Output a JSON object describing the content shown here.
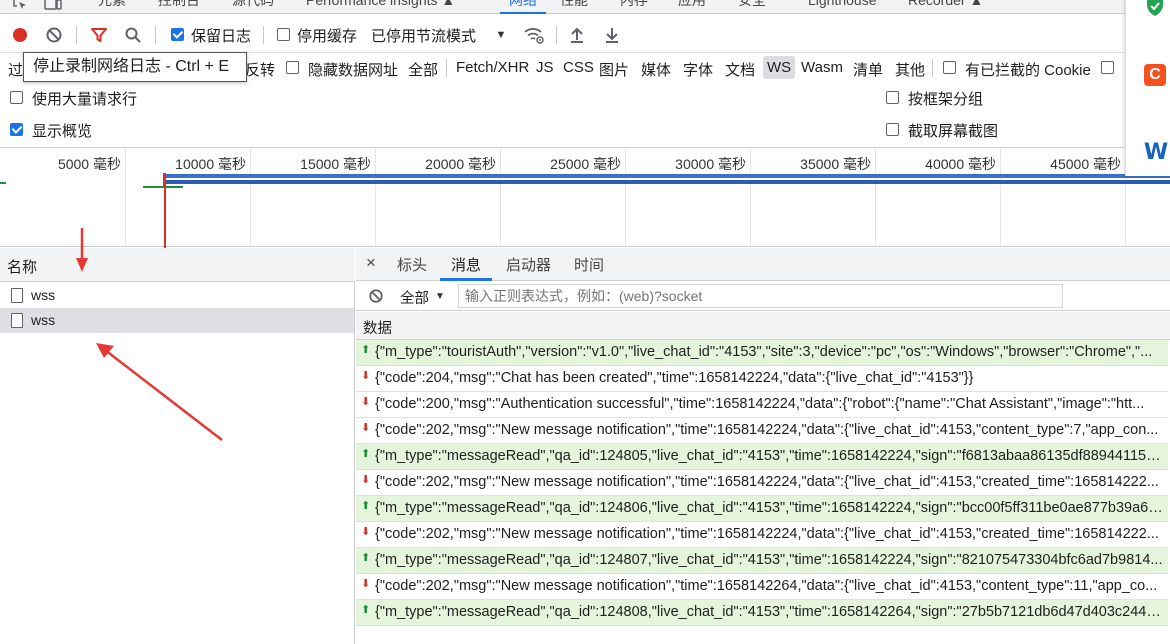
{
  "top_tabs": [
    {
      "label": "元素"
    },
    {
      "label": "控制台"
    },
    {
      "label": "源代码"
    },
    {
      "label": "Performance insights ▲"
    },
    {
      "label": "网络"
    },
    {
      "label": "性能"
    },
    {
      "label": "内存"
    },
    {
      "label": "应用"
    },
    {
      "label": "安全"
    },
    {
      "label": "Lighthouse"
    },
    {
      "label": "Recorder ▲"
    }
  ],
  "toolbar": {
    "preserve_log_label": "保留日志",
    "preserve_log_checked": true,
    "disable_cache_label": "停用缓存",
    "disable_cache_checked": false,
    "throttle_label": "已停用节流模式"
  },
  "tooltip": {
    "text": "停止录制网络日志 - Ctrl + E"
  },
  "filter_bar": {
    "filter_prefix": "过",
    "invert_label": "反转",
    "hide_data_urls_label": "隐藏数据网址",
    "types": [
      "全部",
      "Fetch/XHR",
      "JS",
      "CSS",
      "图片",
      "媒体",
      "字体",
      "文档",
      "WS",
      "Wasm",
      "清单",
      "其他"
    ],
    "active_type": "WS",
    "blocked_cookies_label": "有已拦截的 Cookie"
  },
  "options": {
    "large_rows_label": "使用大量请求行",
    "large_rows_checked": false,
    "group_by_frame_label": "按框架分组",
    "group_by_frame_checked": false,
    "show_overview_label": "显示概览",
    "show_overview_checked": true,
    "screenshots_label": "截取屏幕截图",
    "screenshots_checked": false
  },
  "timeline": {
    "ticks": [
      "5000 毫秒",
      "10000 毫秒",
      "15000 毫秒",
      "20000 毫秒",
      "25000 毫秒",
      "30000 毫秒",
      "35000 毫秒",
      "40000 毫秒",
      "45000 毫秒"
    ]
  },
  "name_panel": {
    "header": "名称",
    "rows": [
      {
        "name": "wss",
        "selected": false
      },
      {
        "name": "wss",
        "selected": true
      }
    ]
  },
  "detail_panel": {
    "close_glyph": "×",
    "tabs": [
      "标头",
      "消息",
      "启动器",
      "时间"
    ],
    "active_tab": "消息",
    "filter_select": "全部",
    "filter_placeholder": "输入正则表达式，例如：(web)?socket",
    "data_header": "数据",
    "messages": [
      {
        "dir": "sent",
        "text": "{\"m_type\":\"touristAuth\",\"version\":\"v1.0\",\"live_chat_id\":\"4153\",\"site\":3,\"device\":\"pc\",\"os\":\"Windows\",\"browser\":\"Chrome\",\"..."
      },
      {
        "dir": "recv",
        "text": "{\"code\":204,\"msg\":\"Chat has been created\",\"time\":1658142224,\"data\":{\"live_chat_id\":\"4153\"}}"
      },
      {
        "dir": "recv",
        "text": "{\"code\":200,\"msg\":\"Authentication successful\",\"time\":1658142224,\"data\":{\"robot\":{\"name\":\"Chat Assistant\",\"image\":\"htt..."
      },
      {
        "dir": "recv",
        "text": "{\"code\":202,\"msg\":\"New message notification\",\"time\":1658142224,\"data\":{\"live_chat_id\":4153,\"content_type\":7,\"app_con..."
      },
      {
        "dir": "sent",
        "text": "{\"m_type\":\"messageRead\",\"qa_id\":124805,\"live_chat_id\":\"4153\",\"time\":1658142224,\"sign\":\"f6813abaa86135df88944115a..."
      },
      {
        "dir": "recv",
        "text": "{\"code\":202,\"msg\":\"New message notification\",\"time\":1658142224,\"data\":{\"live_chat_id\":4153,\"created_time\":165814222..."
      },
      {
        "dir": "sent",
        "text": "{\"m_type\":\"messageRead\",\"qa_id\":124806,\"live_chat_id\":\"4153\",\"time\":1658142224,\"sign\":\"bcc00f5ff311be0ae877b39a6c..."
      },
      {
        "dir": "recv",
        "text": "{\"code\":202,\"msg\":\"New message notification\",\"time\":1658142224,\"data\":{\"live_chat_id\":4153,\"created_time\":165814222..."
      },
      {
        "dir": "sent",
        "text": "{\"m_type\":\"messageRead\",\"qa_id\":124807,\"live_chat_id\":\"4153\",\"time\":1658142224,\"sign\":\"821075473304bfc6ad7b9814..."
      },
      {
        "dir": "recv",
        "text": "{\"code\":202,\"msg\":\"New message notification\",\"time\":1658142264,\"data\":{\"live_chat_id\":4153,\"content_type\":11,\"app_co..."
      },
      {
        "dir": "sent",
        "text": "{\"m_type\":\"messageRead\",\"qa_id\":124808,\"live_chat_id\":\"4153\",\"time\":1658142264,\"sign\":\"27b5b7121db6d47d403c2446..."
      }
    ]
  },
  "colors": {
    "accent": "#1a73e8",
    "record_red": "#d93025",
    "sent_bg": "#e5f5dc",
    "sent_arrow": "#1e8e3e",
    "recv_arrow": "#d93025",
    "annotation_red": "#e53935"
  },
  "extensions": [
    "shield-check-extension-icon",
    "c-extension-icon",
    "w-extension-icon"
  ],
  "extension_labels": {
    "c": "C",
    "w": "W"
  }
}
